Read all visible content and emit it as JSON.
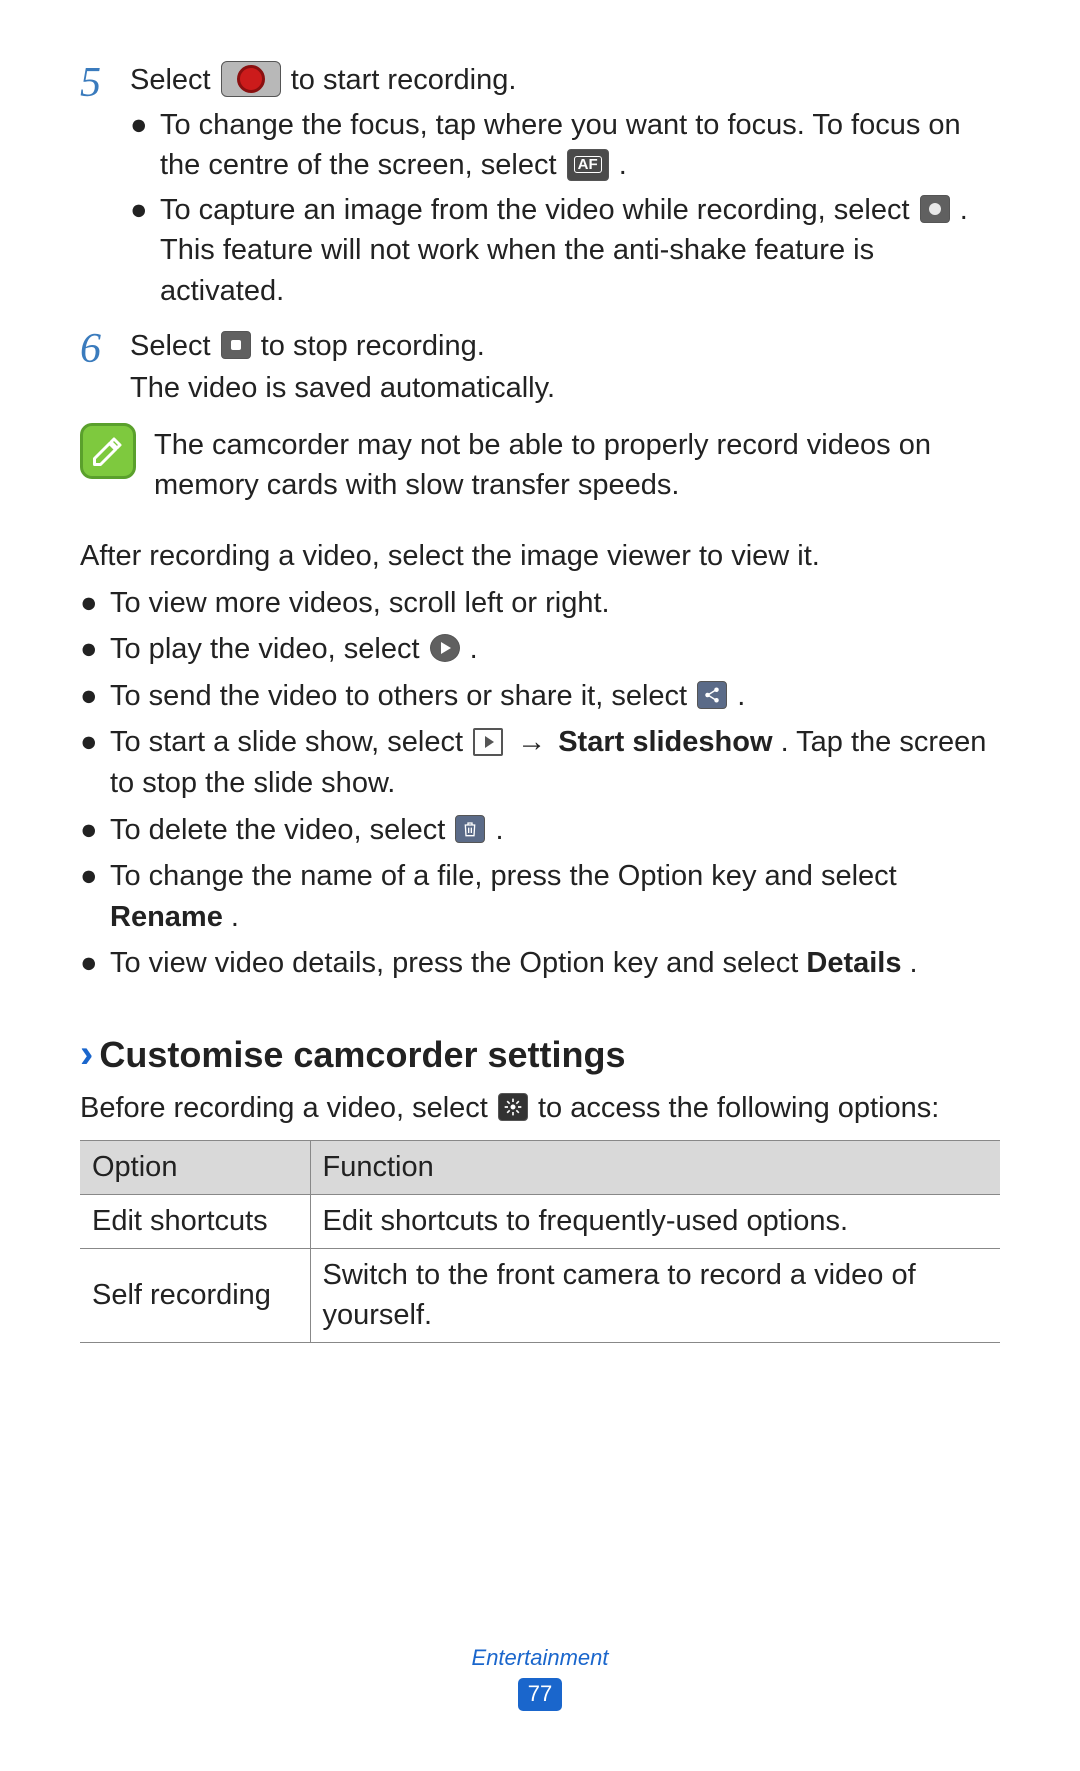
{
  "steps": {
    "5": {
      "num": "5",
      "main_a": "Select ",
      "main_b": " to start recording.",
      "sub1_a": "To change the focus, tap where you want to focus. To focus on the centre of the screen, select ",
      "sub1_b": ".",
      "sub2_a": "To capture an image from the video while recording, select ",
      "sub2_b": ". This feature will not work when the anti-shake feature is activated."
    },
    "6": {
      "num": "6",
      "main_a": "Select ",
      "main_b": " to stop recording.",
      "line2": "The video is saved automatically."
    }
  },
  "note": "The camcorder may not be able to properly record videos on memory cards with slow transfer speeds.",
  "after": "After recording a video, select the image viewer to view it.",
  "bullets": {
    "b1": "To view more videos, scroll left or right.",
    "b2_a": "To play the video, select ",
    "b2_b": ".",
    "b3_a": "To send the video to others or share it, select ",
    "b3_b": ".",
    "b4_a": "To start a slide show, select ",
    "b4_arrow": " → ",
    "b4_bold": "Start slideshow",
    "b4_b": ". Tap the screen to stop the slide show.",
    "b5_a": "To delete the video, select ",
    "b5_b": ".",
    "b6_a": "To change the name of a file, press the Option key and select ",
    "b6_bold": "Rename",
    "b6_b": ".",
    "b7_a": "To view video details, press the Option key and select ",
    "b7_bold": "Details",
    "b7_b": "."
  },
  "section": {
    "title": "Customise camcorder settings",
    "intro_a": "Before recording a video, select ",
    "intro_b": " to access the following options:"
  },
  "table": {
    "h1": "Option",
    "h2": "Function",
    "r1c1": "Edit shortcuts",
    "r1c2": "Edit shortcuts to frequently-used options.",
    "r2c1": "Self recording",
    "r2c2": "Switch to the front camera to record a video of yourself."
  },
  "icons": {
    "af": "AF"
  },
  "footer": {
    "category": "Entertainment",
    "page": "77"
  }
}
